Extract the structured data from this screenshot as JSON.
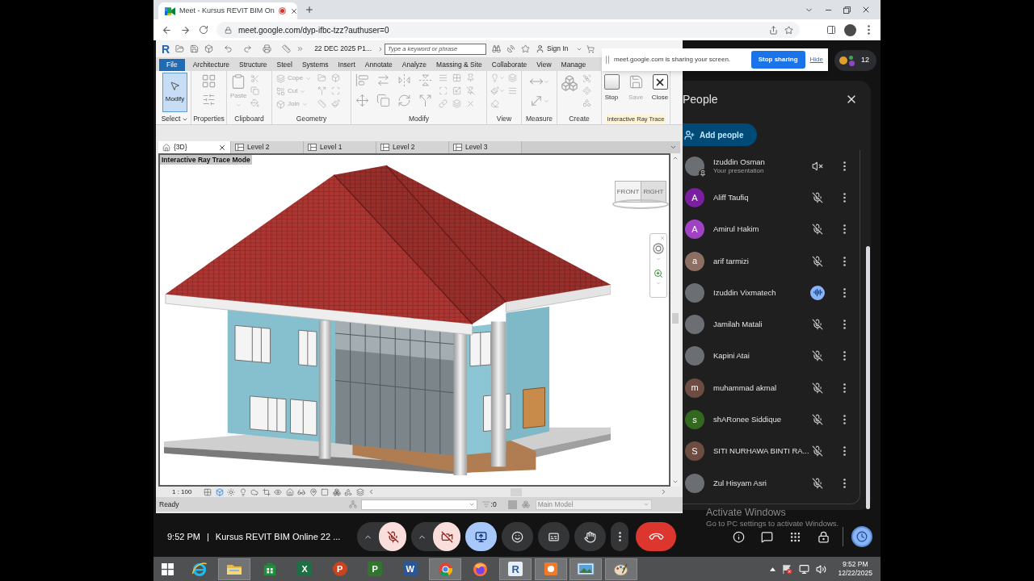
{
  "browser": {
    "tab": {
      "title": "Meet - Kursus REVIT BIM On",
      "recording": true
    },
    "url": "meet.google.com/dyp-ifbc-tzz?authuser=0"
  },
  "revit": {
    "logo": "R",
    "document": "22 DEC 2025 P1...",
    "search": {
      "placeholder": "Type a keyword or phrase"
    },
    "sign_in": "Sign In",
    "file_tab": "File",
    "tabs": [
      {
        "label": "Architecture",
        "selected": false
      },
      {
        "label": "Structure",
        "selected": false
      },
      {
        "label": "Steel",
        "selected": false
      },
      {
        "label": "Systems",
        "selected": false
      },
      {
        "label": "Insert",
        "selected": false
      },
      {
        "label": "Annotate",
        "selected": false
      },
      {
        "label": "Analyze",
        "selected": false
      },
      {
        "label": "Massing & Site",
        "selected": false
      },
      {
        "label": "Collaborate",
        "selected": false
      },
      {
        "label": "View",
        "selected": false
      },
      {
        "label": "Manage",
        "selected": false
      }
    ],
    "panels": [
      {
        "kind": "select",
        "label": "Select",
        "dropdown": true,
        "tools": [
          {
            "label": "Modify",
            "selected": true
          }
        ]
      },
      {
        "kind": "properties",
        "label": "Properties"
      },
      {
        "kind": "clipboard",
        "label": "Clipboard",
        "tools": [
          {
            "label": "Paste",
            "disabled": true
          }
        ]
      },
      {
        "kind": "geometry",
        "label": "Geometry",
        "tools": [
          {
            "label": "Cope",
            "disabled": true
          },
          {
            "label": "Cut",
            "disabled": true
          },
          {
            "label": "Join",
            "disabled": true
          }
        ]
      },
      {
        "kind": "modify",
        "label": "Modify"
      },
      {
        "kind": "view",
        "label": "View"
      },
      {
        "kind": "measure",
        "label": "Measure"
      },
      {
        "kind": "create",
        "label": "Create"
      },
      {
        "kind": "raytrace",
        "label": "Interactive Ray Trace",
        "highlight": true,
        "tools": [
          {
            "label": "Stop",
            "disabled": false
          },
          {
            "label": "Save",
            "disabled": true
          },
          {
            "label": "Close",
            "disabled": false
          }
        ]
      }
    ],
    "view_tabs": [
      {
        "kind": "perspective",
        "label": "{3D}",
        "selected": true
      },
      {
        "kind": "plan",
        "label": "Level 2",
        "selected": false
      },
      {
        "kind": "plan",
        "label": "Level 1",
        "selected": false
      },
      {
        "kind": "plan",
        "label": "Level 2",
        "selected": false
      },
      {
        "kind": "plan",
        "label": "Level 3",
        "selected": false
      }
    ],
    "viewport": {
      "mode": "Interactive Ray Trace Mode",
      "viewcube": {
        "front": "FRONT",
        "right": "RIGHT"
      }
    },
    "scale": "1 : 100",
    "status": {
      "text": "Ready",
      "selection": ":0",
      "model": "Main Model"
    }
  },
  "share_notice": {
    "message": "meet.google.com is sharing your screen.",
    "stop_button": "Stop sharing",
    "hide_link": "Hide"
  },
  "participant_count": "12",
  "people": {
    "title": "People",
    "add_button": "Add people",
    "participants": [
      {
        "kind": "presentation",
        "name": "Izuddin Osman",
        "subtitle": "Your presentation",
        "avatar": {
          "kind": "photo"
        },
        "muted": true,
        "speaking": false
      },
      {
        "kind": "person",
        "name": "Aliff Taufiq",
        "avatar": {
          "kind": "letter",
          "letter": "A",
          "color": "#7b1fa2"
        },
        "muted": true,
        "speaking": false
      },
      {
        "kind": "person",
        "name": "Amirul Hakim",
        "avatar": {
          "kind": "letter",
          "letter": "A",
          "color": "#a142c4"
        },
        "muted": true,
        "speaking": false
      },
      {
        "kind": "person",
        "name": "arif tarmizi",
        "avatar": {
          "kind": "letter",
          "letter": "a",
          "color": "#8d6e63"
        },
        "muted": true,
        "speaking": false
      },
      {
        "kind": "person",
        "name": "Izuddin Vixmatech",
        "avatar": {
          "kind": "photo"
        },
        "muted": false,
        "speaking": true
      },
      {
        "kind": "person",
        "name": "Jamilah Matali",
        "avatar": {
          "kind": "photo"
        },
        "muted": true,
        "speaking": false
      },
      {
        "kind": "person",
        "name": "Kapini Atai",
        "avatar": {
          "kind": "photo"
        },
        "muted": true,
        "speaking": false
      },
      {
        "kind": "person",
        "name": "muhammad akmal",
        "avatar": {
          "kind": "letter",
          "letter": "m",
          "color": "#6d4c41"
        },
        "muted": true,
        "speaking": false
      },
      {
        "kind": "person",
        "name": "shARonee Siddique",
        "avatar": {
          "kind": "letter",
          "letter": "s",
          "color": "#33691e"
        },
        "muted": true,
        "speaking": false
      },
      {
        "kind": "person",
        "name": "SITI NURHAWA BINTI RA...",
        "avatar": {
          "kind": "letter",
          "letter": "S",
          "color": "#6d4c41"
        },
        "muted": true,
        "speaking": false
      },
      {
        "kind": "person",
        "name": "Zul Hisyam Asri",
        "avatar": {
          "kind": "photo"
        },
        "muted": true,
        "speaking": false
      }
    ]
  },
  "call_bar": {
    "time": "9:52 PM",
    "separator": "|",
    "meeting_title": "Kursus REVIT BIM Online 22 ...",
    "controls": [
      {
        "kind": "mic",
        "on": false,
        "menu": true
      },
      {
        "kind": "camera",
        "on": false,
        "menu": true
      },
      {
        "kind": "present",
        "on": true
      },
      {
        "kind": "reactions"
      },
      {
        "kind": "captions",
        "on": false
      },
      {
        "kind": "hand",
        "on": false
      },
      {
        "kind": "more"
      },
      {
        "kind": "leave"
      }
    ],
    "side_controls": [
      {
        "kind": "info"
      },
      {
        "kind": "chat"
      },
      {
        "kind": "activities"
      },
      {
        "kind": "host"
      },
      {
        "kind": "timer"
      }
    ]
  },
  "windows_notice": {
    "title": "Activate Windows",
    "hint": "Go to PC settings to activate Windows."
  },
  "taskbar": {
    "apps": [
      {
        "kind": "ie",
        "running": false
      },
      {
        "kind": "explorer",
        "running": true
      },
      {
        "kind": "store",
        "running": false
      },
      {
        "kind": "excel",
        "glyph": "X",
        "running": false
      },
      {
        "kind": "powerpoint",
        "glyph": "P",
        "running": false
      },
      {
        "kind": "project",
        "glyph": "P",
        "running": false
      },
      {
        "kind": "word",
        "glyph": "W",
        "running": false
      },
      {
        "kind": "chrome",
        "running": true
      },
      {
        "kind": "firefox",
        "running": false
      },
      {
        "kind": "revit",
        "glyph": "R",
        "running": true
      },
      {
        "kind": "recorder",
        "running": true
      },
      {
        "kind": "photos",
        "running": true
      },
      {
        "kind": "paint",
        "running": true
      }
    ],
    "time": "9:52 PM",
    "date": "12/22/2025"
  }
}
